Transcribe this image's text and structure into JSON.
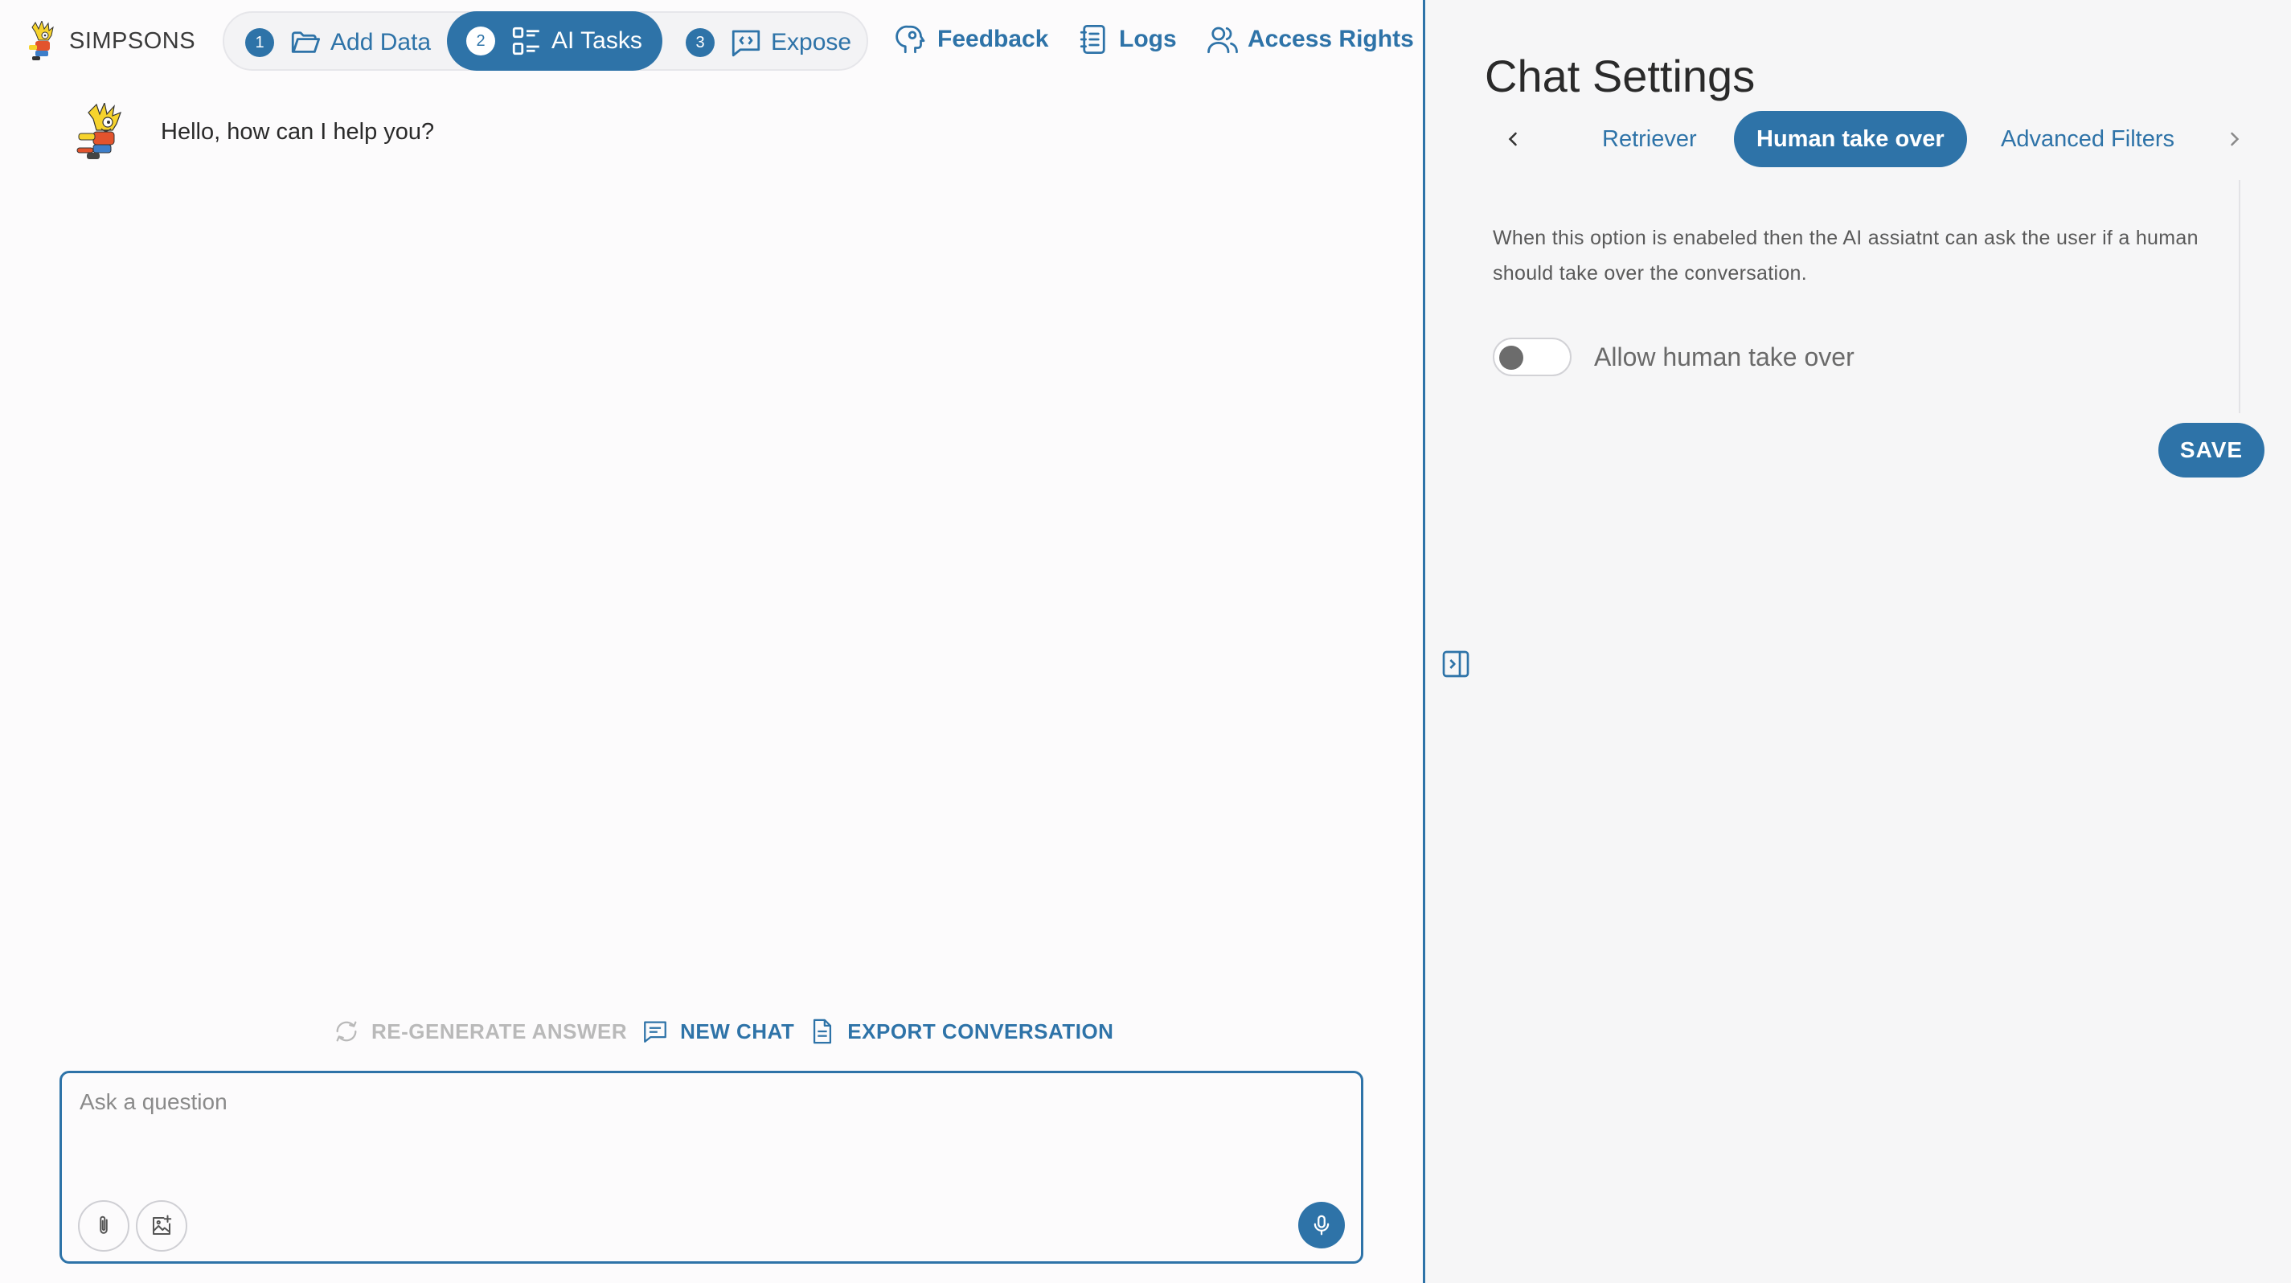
{
  "app": {
    "name": "SIMPSONS"
  },
  "stepper": {
    "steps": [
      {
        "number": "1",
        "label": "Add Data",
        "icon": "folder-icon"
      },
      {
        "number": "2",
        "label": "AI Tasks",
        "icon": "grid-list-icon"
      },
      {
        "number": "3",
        "label": "Expose",
        "icon": "code-chat-icon"
      }
    ],
    "active": "AI Tasks"
  },
  "nav": {
    "feedback": "Feedback",
    "logs": "Logs",
    "access_rights": "Access Rights"
  },
  "chat": {
    "assistant_message": "Hello, how can I help you?",
    "actions": {
      "regenerate": "RE-GENERATE ANSWER",
      "new_chat": "NEW CHAT",
      "export": "EXPORT CONVERSATION"
    },
    "input": {
      "placeholder": "Ask a question",
      "value": ""
    }
  },
  "settings": {
    "title": "Chat Settings",
    "tabs": [
      "Retriever",
      "Human take over",
      "Advanced Filters"
    ],
    "active_tab": "Human take over",
    "description": "When this option is enabeled then the AI assiatnt can ask the user if a human should take over the conversation.",
    "toggle_label": "Allow human take over",
    "toggle_on": false,
    "save_label": "SAVE"
  },
  "colors": {
    "accent": "#2e73a8",
    "background": "#fcfbfc",
    "panel": "#f6f6f7"
  }
}
